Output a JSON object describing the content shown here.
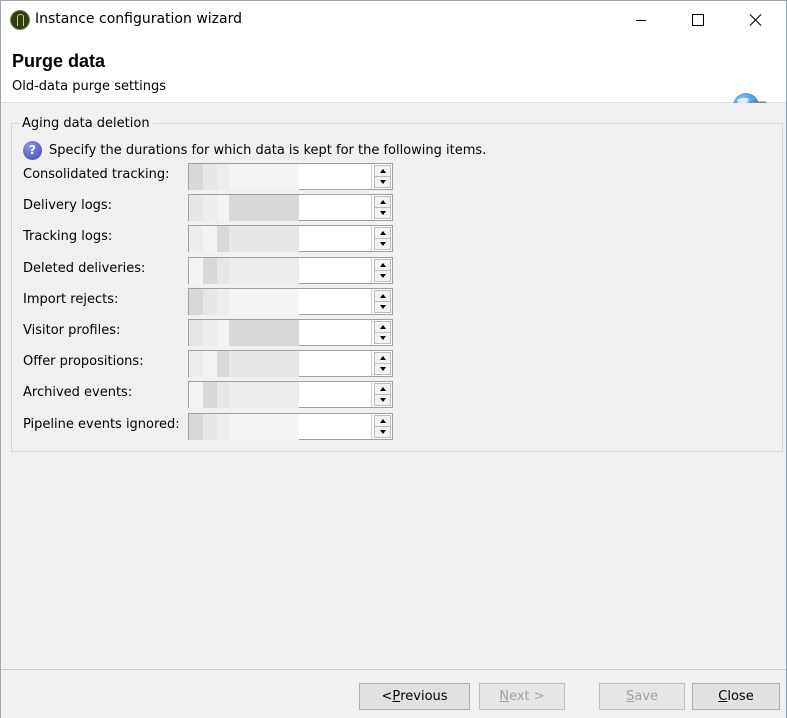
{
  "window": {
    "title": "Instance configuration wizard"
  },
  "header": {
    "title": "Purge data",
    "subtitle": "Old-data purge settings"
  },
  "group": {
    "legend": "Aging data deletion",
    "info": "Specify the durations for which data is kept for the following items."
  },
  "fields": [
    {
      "label": "Consolidated tracking:",
      "value": ""
    },
    {
      "label": "Delivery logs:",
      "value": ""
    },
    {
      "label": "Tracking logs:",
      "value": ""
    },
    {
      "label": "Deleted deliveries:",
      "value": ""
    },
    {
      "label": "Import rejects:",
      "value": ""
    },
    {
      "label": "Visitor profiles:",
      "value": ""
    },
    {
      "label": "Offer propositions:",
      "value": ""
    },
    {
      "label": "Archived events:",
      "value": ""
    },
    {
      "label": "Pipeline events ignored:",
      "value": ""
    }
  ],
  "footer": {
    "previous_prefix": "< ",
    "previous_key": "P",
    "previous_rest": "revious",
    "next_key": "N",
    "next_rest": "ext >",
    "save_key": "S",
    "save_rest": "ave",
    "close_key": "C",
    "close_rest": "lose"
  },
  "colors": {
    "dialog_bg": "#f0f0f0",
    "button_bg": "#e1e1e1",
    "disabled_text": "#a0a0a0",
    "help_icon": "#3a45b5"
  },
  "icons": {
    "app": "app-logo-icon",
    "header": "server-globe-icon",
    "help": "question-icon"
  }
}
